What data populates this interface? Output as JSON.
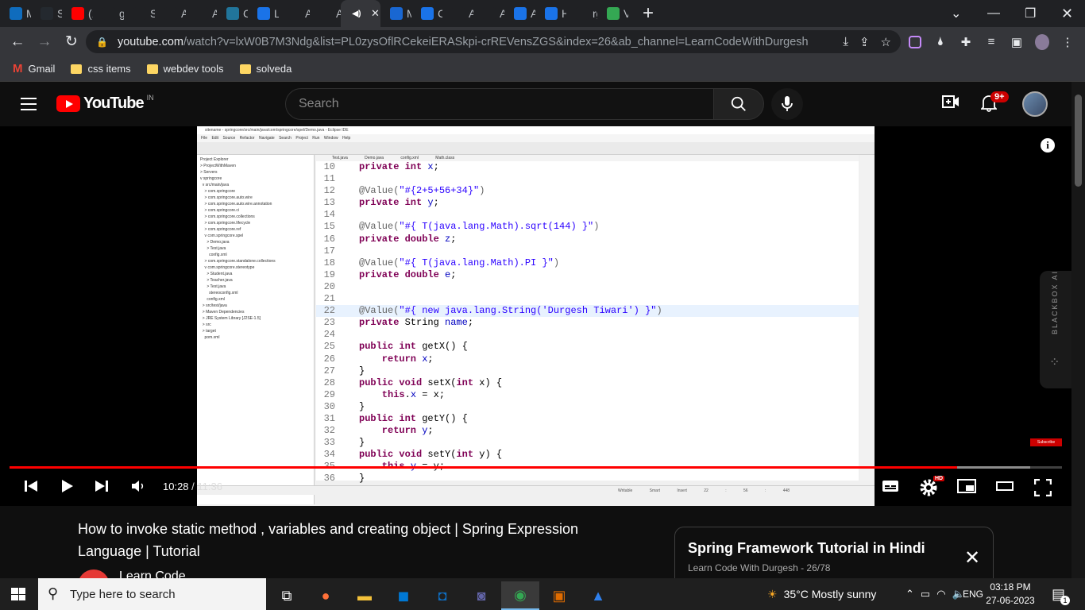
{
  "browser": {
    "tabs": [
      {
        "label": "Ma",
        "icon": "outlook-icon",
        "color": "#0f6cbd"
      },
      {
        "label": "Sp",
        "icon": "github-icon",
        "color": "#24292f"
      },
      {
        "label": "(12",
        "icon": "youtube-icon",
        "color": "#ff0000"
      },
      {
        "label": "gre",
        "icon": "chatgpt-icon",
        "color": "#202124"
      },
      {
        "label": "Sm",
        "icon": "chatgpt-icon",
        "color": "#202124"
      },
      {
        "label": "Ab",
        "icon": "chatgpt-icon",
        "color": "#202124"
      },
      {
        "label": "Ab",
        "icon": "chatgpt-icon",
        "color": "#202124"
      },
      {
        "label": "Cre",
        "icon": "wordpress-icon",
        "color": "#21759b"
      },
      {
        "label": "Lo",
        "icon": "vscode-icon",
        "color": "#1a73e8"
      },
      {
        "label": "Ac",
        "icon": "chatgpt-icon",
        "color": "#202124"
      },
      {
        "label": "Ab",
        "icon": "chatgpt-icon",
        "color": "#202124"
      },
      {
        "label": "",
        "icon": "audio-playing-icon",
        "color": "#35363a",
        "active": true
      },
      {
        "label": "Ma",
        "icon": "mail-icon",
        "color": "#1967d2"
      },
      {
        "label": "CA",
        "icon": "vscode-icon",
        "color": "#1a73e8"
      },
      {
        "label": "Ac",
        "icon": "chatgpt-icon",
        "color": "#202124"
      },
      {
        "label": "Ac",
        "icon": "chatgpt-icon",
        "color": "#202124"
      },
      {
        "label": "Att",
        "icon": "vscode-icon",
        "color": "#1a73e8"
      },
      {
        "label": "HC",
        "icon": "vscode-icon",
        "color": "#1a73e8"
      },
      {
        "label": "rgi",
        "icon": "loading-icon",
        "color": "#202124"
      },
      {
        "label": "VN",
        "icon": "vm-icon",
        "color": "#34a853"
      }
    ],
    "new_tab": "+",
    "url_domain": "youtube.com",
    "url_rest": "/watch?v=lxW0B7M3Ndg&list=PL0zysOflRCekeiERASkpi-crREVensZGS&index=26&ab_channel=LearnCodeWithDurgesh",
    "bookmarks": [
      {
        "label": "Gmail",
        "icon": "gmail-icon"
      },
      {
        "label": "css items",
        "icon": "folder-icon"
      },
      {
        "label": "webdev tools",
        "icon": "folder-icon"
      },
      {
        "label": "solveda",
        "icon": "folder-icon"
      }
    ]
  },
  "youtube": {
    "logo_text": "YouTube",
    "country": "IN",
    "search_placeholder": "Search",
    "notification_count": "9+"
  },
  "player": {
    "current_time": "10:28",
    "separator": " / ",
    "duration": "11:36",
    "progress_fraction": 0.9,
    "buffered_fraction": 0.97,
    "hd_label": "HD",
    "subscribe_mini": "Subscribe",
    "blackbox_label": "BLACKBOX AI"
  },
  "eclipse": {
    "title": "sitename - springcore/src/main/java/com/springcore/spel/Demo.java - Eclipse IDE",
    "menu": "File Edit Source Refactor Navigate Search Project Run Window Help",
    "editor_tabs": "Test.java Demo.java config.xml Math.class",
    "explorer": [
      "Project Explorer",
      "> ProjectWithMaven",
      "> Servers",
      "v springcore",
      "  v src/main/java",
      "    > com.springcore",
      "    > com.springcore.auto.wire",
      "    > com.springcore.auto.wire.annotation",
      "    > com.springcore.ci",
      "    > com.springcore.collections",
      "    > com.springcore.lifecycle",
      "    > com.springcore.ref",
      "    v com.springcore.spel",
      "      > Demo.java",
      "      > Test.java",
      "        config.xml",
      "    > com.springcore.standalone.collections",
      "    v com.springcore.stereotype",
      "      > Student.java",
      "      > Teacher.java",
      "      > Test.java",
      "        stereoconfig.xml",
      "      config.xml",
      "  > src/test/java",
      "  > Maven Dependencies",
      "  > JRE System Library [J2SE-1.5]",
      "  > src",
      "  > target",
      "    pom.xml"
    ],
    "code": [
      {
        "n": "10",
        "html": [
          [
            "kw",
            "private int "
          ],
          [
            "fld",
            "x"
          ],
          [
            "",
            "; "
          ]
        ]
      },
      {
        "n": "11",
        "html": []
      },
      {
        "n": "12",
        "html": [
          [
            "an",
            "@Value("
          ],
          [
            "st",
            "\"#{2+5+56+34}\""
          ],
          [
            "an",
            ")"
          ]
        ]
      },
      {
        "n": "13",
        "html": [
          [
            "kw",
            "private int "
          ],
          [
            "fld",
            "y"
          ],
          [
            "",
            ";"
          ]
        ]
      },
      {
        "n": "14",
        "html": []
      },
      {
        "n": "15",
        "html": [
          [
            "an",
            "@Value("
          ],
          [
            "st",
            "\"#{ T(java.lang.Math).sqrt(144) }\""
          ],
          [
            "an",
            ")"
          ]
        ]
      },
      {
        "n": "16",
        "html": [
          [
            "kw",
            "private double "
          ],
          [
            "fld",
            "z"
          ],
          [
            "",
            ";"
          ]
        ]
      },
      {
        "n": "17",
        "html": []
      },
      {
        "n": "18",
        "html": [
          [
            "an",
            "@Value("
          ],
          [
            "st",
            "\"#{ T(java.lang.Math).PI }\""
          ],
          [
            "an",
            ")"
          ]
        ]
      },
      {
        "n": "19",
        "html": [
          [
            "kw",
            "private double "
          ],
          [
            "fld",
            "e"
          ],
          [
            "",
            ";"
          ]
        ]
      },
      {
        "n": "20",
        "html": []
      },
      {
        "n": "21",
        "html": []
      },
      {
        "n": "22",
        "html": [
          [
            "an",
            "@Value("
          ],
          [
            "st",
            "\"#{ new java.lang.String('Durgesh Tiwari') }\""
          ],
          [
            "an",
            ")"
          ]
        ],
        "hl": true
      },
      {
        "n": "23",
        "html": [
          [
            "kw",
            "private "
          ],
          [
            "",
            "String "
          ],
          [
            "fld",
            "name"
          ],
          [
            "",
            ";"
          ]
        ]
      },
      {
        "n": "24",
        "html": []
      },
      {
        "n": "25",
        "html": [
          [
            "kw",
            "public int "
          ],
          [
            "",
            "getX() {"
          ]
        ]
      },
      {
        "n": "26",
        "html": [
          [
            "kw",
            "    return "
          ],
          [
            "fld",
            "x"
          ],
          [
            "",
            ";"
          ]
        ]
      },
      {
        "n": "27",
        "html": [
          [
            "",
            "}"
          ]
        ]
      },
      {
        "n": "28",
        "html": [
          [
            "kw",
            "public void "
          ],
          [
            "",
            "setX("
          ],
          [
            "kw",
            "int "
          ],
          [
            "",
            "x) {"
          ]
        ]
      },
      {
        "n": "29",
        "html": [
          [
            "kw",
            "    this"
          ],
          [
            "",
            "."
          ],
          [
            "fld",
            "x"
          ],
          [
            "",
            " = x;"
          ]
        ]
      },
      {
        "n": "30",
        "html": [
          [
            "",
            "}"
          ]
        ]
      },
      {
        "n": "31",
        "html": [
          [
            "kw",
            "public int "
          ],
          [
            "",
            "getY() {"
          ]
        ]
      },
      {
        "n": "32",
        "html": [
          [
            "kw",
            "    return "
          ],
          [
            "fld",
            "y"
          ],
          [
            "",
            ";"
          ]
        ]
      },
      {
        "n": "33",
        "html": [
          [
            "",
            "}"
          ]
        ]
      },
      {
        "n": "34",
        "html": [
          [
            "kw",
            "public void "
          ],
          [
            "",
            "setY("
          ],
          [
            "kw",
            "int "
          ],
          [
            "",
            "y) {"
          ]
        ]
      },
      {
        "n": "35",
        "html": [
          [
            "kw",
            "    this"
          ],
          [
            "",
            "."
          ],
          [
            "fld",
            "y"
          ],
          [
            "",
            " = y;"
          ]
        ]
      },
      {
        "n": "36",
        "html": [
          [
            "",
            "}"
          ]
        ]
      }
    ],
    "status": "Writable    Smart Insert    22 : 56 : 448"
  },
  "video": {
    "title": "How to invoke static method , variables and creating object | Spring Expression Language | Tutorial",
    "channel": "Learn Code"
  },
  "playlist": {
    "title": "Spring Framework Tutorial in Hindi",
    "subtitle": "Learn Code With Durgesh - 26/78"
  },
  "taskbar": {
    "search_placeholder": "Type here to search",
    "weather": "35°C  Mostly sunny",
    "language": "ENG",
    "time": "03:18 PM",
    "date": "27-06-2023",
    "notification_count": "1"
  }
}
